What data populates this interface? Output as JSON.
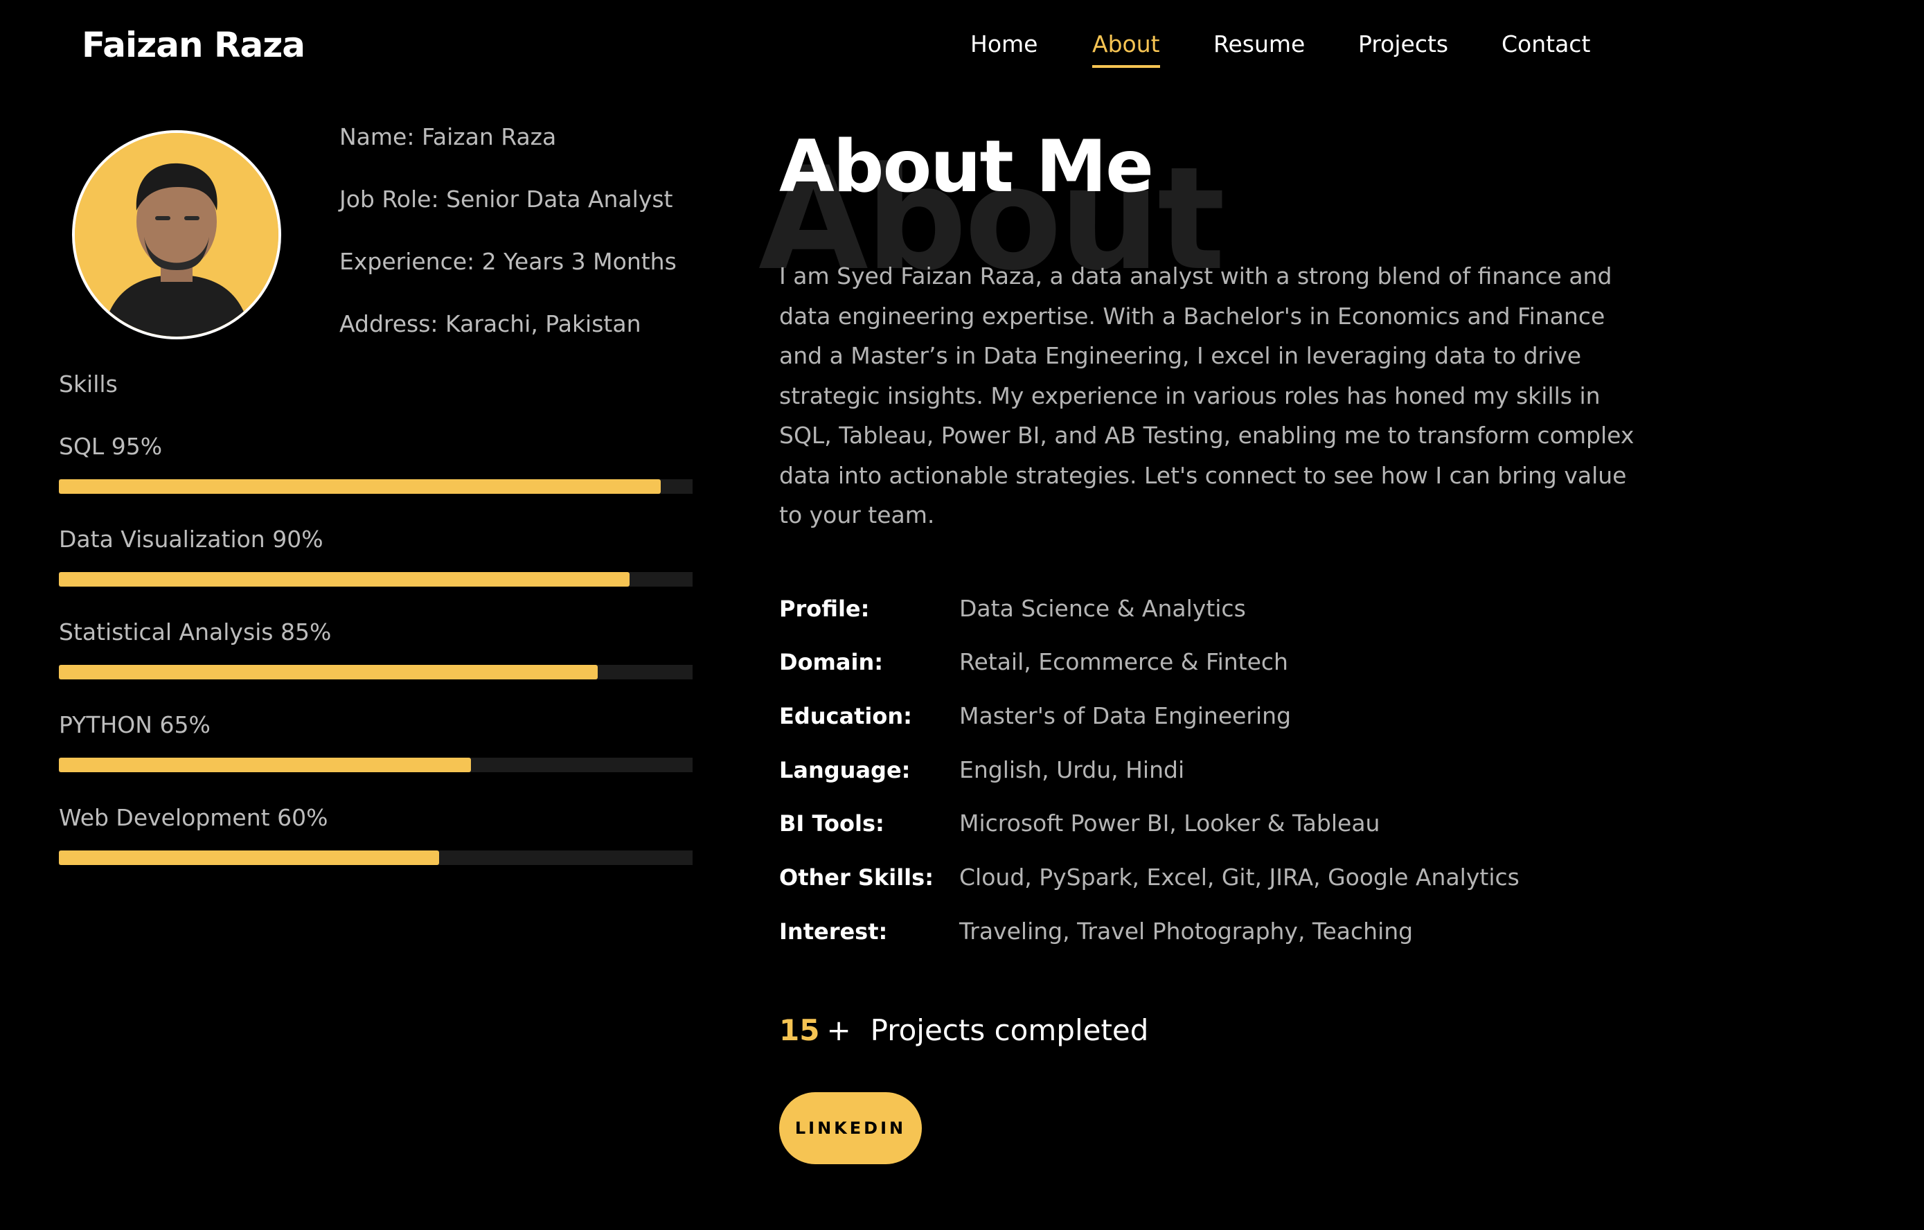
{
  "brand": {
    "name": "Faizan Raza"
  },
  "nav": {
    "items": [
      {
        "label": "Home",
        "active": false
      },
      {
        "label": "About",
        "active": true
      },
      {
        "label": "Resume",
        "active": false
      },
      {
        "label": "Projects",
        "active": false
      },
      {
        "label": "Contact",
        "active": false
      }
    ]
  },
  "profile": {
    "avatar_icon": "profile-photo",
    "info": [
      "Name: Faizan Raza",
      "Job Role: Senior Data Analyst",
      "Experience: 2 Years 3 Months",
      "Address: Karachi, Pakistan"
    ]
  },
  "skills": {
    "title": "Skills",
    "items": [
      {
        "label": "SQL 95%",
        "level": 0.95
      },
      {
        "label": "Data Visualization 90%",
        "level": 0.9
      },
      {
        "label": "Statistical Analysis 85%",
        "level": 0.85
      },
      {
        "label": "PYTHON 65%",
        "level": 0.65
      },
      {
        "label": "Web Development 60%",
        "level": 0.6
      }
    ]
  },
  "about": {
    "ghost_text": "About",
    "heading": "About Me",
    "bio": "I am Syed Faizan Raza, a data analyst with a strong blend of finance and data engineering expertise. With a Bachelor's in Economics and Finance and a Master’s in Data Engineering, I excel in leveraging data to drive strategic insights. My experience in various roles has honed my skills in SQL, Tableau, Power BI, and AB Testing, enabling me to transform complex data into actionable strategies. Let's connect to see how I can bring value to your team."
  },
  "details": [
    {
      "label": "Profile:",
      "value": "Data Science & Analytics"
    },
    {
      "label": "Domain:",
      "value": "Retail, Ecommerce & Fintech"
    },
    {
      "label": "Education:",
      "value": "Master's of Data Engineering"
    },
    {
      "label": "Language:",
      "value": "English, Urdu, Hindi"
    },
    {
      "label": "BI Tools:",
      "value": "Microsoft Power BI, Looker & Tableau"
    },
    {
      "label": "Other Skills:",
      "value": "Cloud, PySpark, Excel, Git, JIRA, Google Analytics"
    },
    {
      "label": "Interest:",
      "value": "Traveling, Travel Photography, Teaching"
    }
  ],
  "counter": {
    "number": "15",
    "plus": "+",
    "label": "Projects completed"
  },
  "cta": {
    "linkedin_label": "LINKEDIN"
  },
  "colors": {
    "accent": "#f6c453",
    "background": "#000000",
    "muted_text": "#b5b5b5",
    "track": "#1c1c1c"
  }
}
